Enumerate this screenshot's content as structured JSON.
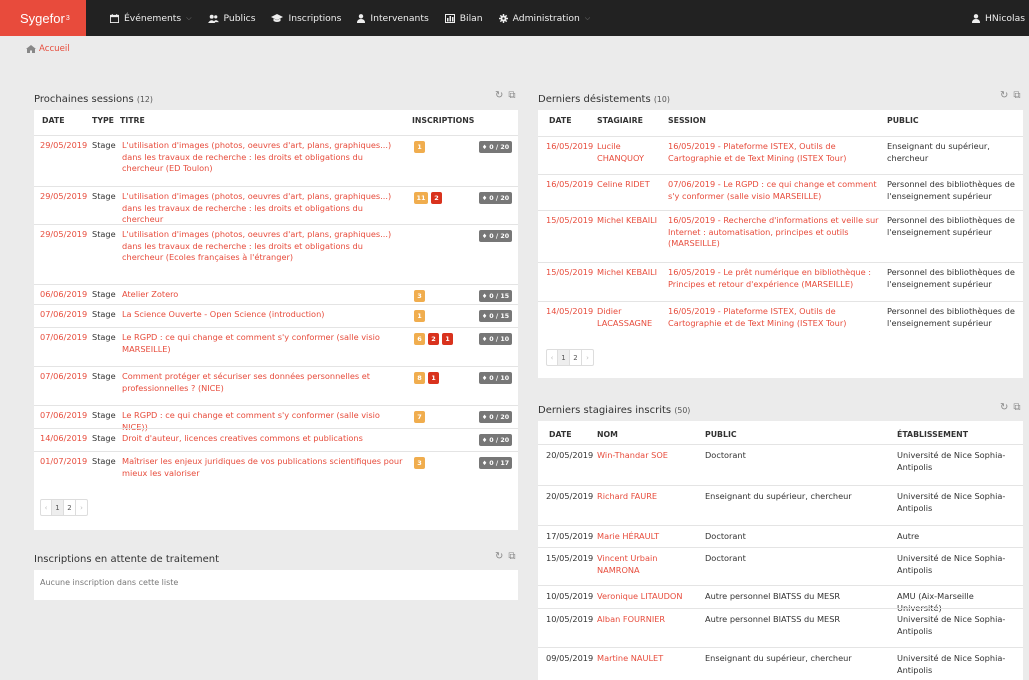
{
  "navbar": {
    "brand": "Sygefor",
    "brand_sup": "3",
    "items": [
      {
        "label": "Événements",
        "icon": "calendar-icon",
        "dropdown": true
      },
      {
        "label": "Publics",
        "icon": "users-icon",
        "dropdown": false
      },
      {
        "label": "Inscriptions",
        "icon": "graduation-cap-icon",
        "dropdown": false
      },
      {
        "label": "Intervenants",
        "icon": "user-icon",
        "dropdown": false
      },
      {
        "label": "Bilan",
        "icon": "bar-chart-icon",
        "dropdown": false
      },
      {
        "label": "Administration",
        "icon": "gear-icon",
        "dropdown": true
      }
    ],
    "user": "HNicolas"
  },
  "breadcrumb": {
    "label": "Accueil",
    "icon": "home-icon"
  },
  "sessions": {
    "title": "Prochaines sessions",
    "count": "(12)",
    "headers": {
      "date": "DATE",
      "type": "TYPE",
      "titre": "TITRE",
      "inscriptions": "INSCRIPTIONS"
    },
    "rows": [
      {
        "date": "29/05/2019",
        "type": "Stage",
        "title": "L'utilisation d'images (photos, oeuvres d'art, plans, graphiques...) dans les travaux de recherche : les droits et obligations du chercheur (ED Toulon)",
        "badges": [
          {
            "v": "1",
            "c": "orange"
          }
        ],
        "cap": "0 / 20"
      },
      {
        "date": "29/05/2019",
        "type": "Stage",
        "title": "L'utilisation d'images (photos, oeuvres d'art, plans, graphiques...) dans les travaux de recherche : les droits et obligations du chercheur",
        "badges": [
          {
            "v": "11",
            "c": "orange"
          },
          {
            "v": "2",
            "c": "red"
          }
        ],
        "cap": "0 / 20"
      },
      {
        "date": "29/05/2019",
        "type": "Stage",
        "title": "L'utilisation d'images (photos, oeuvres d'art, plans, graphiques...) dans les travaux de recherche : les droits et obligations du chercheur (Ecoles françaises à l'étranger)",
        "badges": [],
        "cap": "0 / 20"
      },
      {
        "date": "06/06/2019",
        "type": "Stage",
        "title": "Atelier Zotero",
        "badges": [
          {
            "v": "3",
            "c": "orange"
          }
        ],
        "cap": "0 / 15"
      },
      {
        "date": "07/06/2019",
        "type": "Stage",
        "title": "La Science Ouverte - Open Science (introduction)",
        "badges": [
          {
            "v": "1",
            "c": "orange"
          }
        ],
        "cap": "0 / 15"
      },
      {
        "date": "07/06/2019",
        "type": "Stage",
        "title": "Le RGPD : ce qui change et comment s'y conformer (salle visio MARSEILLE)",
        "badges": [
          {
            "v": "6",
            "c": "orange"
          },
          {
            "v": "2",
            "c": "red"
          },
          {
            "v": "1",
            "c": "red"
          }
        ],
        "cap": "0 / 10"
      },
      {
        "date": "07/06/2019",
        "type": "Stage",
        "title": "Comment protéger et sécuriser ses données personnelles et professionnelles ? (NICE)",
        "badges": [
          {
            "v": "8",
            "c": "orange"
          },
          {
            "v": "1",
            "c": "red"
          }
        ],
        "cap": "0 / 10"
      },
      {
        "date": "07/06/2019",
        "type": "Stage",
        "title": "Le RGPD : ce qui change et comment s'y conformer (salle visio NICE))",
        "badges": [
          {
            "v": "7",
            "c": "orange"
          }
        ],
        "cap": "0 / 20"
      },
      {
        "date": "14/06/2019",
        "type": "Stage",
        "title": "Droit d'auteur, licences creatives commons et publications",
        "badges": [],
        "cap": "0 / 20"
      },
      {
        "date": "01/07/2019",
        "type": "Stage",
        "title": "Maîtriser les enjeux juridiques de vos publications scientifiques pour mieux les valoriser",
        "badges": [
          {
            "v": "3",
            "c": "orange"
          }
        ],
        "cap": "0 / 17"
      }
    ],
    "pager": {
      "prev": "‹",
      "pages": [
        "1",
        "2"
      ],
      "next": "›"
    }
  },
  "pending": {
    "title": "Inscriptions en attente de traitement",
    "empty": "Aucune inscription dans cette liste"
  },
  "desist": {
    "title": "Derniers désistements",
    "count": "(10)",
    "headers": {
      "date": "DATE",
      "stagiaire": "STAGIAIRE",
      "session": "SESSION",
      "public": "PUBLIC"
    },
    "rows": [
      {
        "date": "16/05/2019",
        "name": "Lucile CHANQUOY",
        "session": "16/05/2019 - Plateforme ISTEX, Outils de Cartographie et de Text Mining (ISTEX Tour)",
        "public": "Enseignant du supérieur, chercheur"
      },
      {
        "date": "16/05/2019",
        "name": "Celine RIDET",
        "session": "07/06/2019 - Le RGPD : ce qui change et comment s'y conformer (salle visio MARSEILLE)",
        "public": "Personnel des bibliothèques de l'enseignement supérieur"
      },
      {
        "date": "15/05/2019",
        "name": "Michel KEBAILI",
        "session": "16/05/2019 - Recherche d'informations et veille sur Internet : automatisation, principes et outils (MARSEILLE)",
        "public": "Personnel des bibliothèques de l'enseignement supérieur"
      },
      {
        "date": "15/05/2019",
        "name": "Michel KEBAILI",
        "session": "16/05/2019 - Le prêt numérique en bibliothèque : Principes et retour d'expérience (MARSEILLE)",
        "public": "Personnel des bibliothèques de l'enseignement supérieur"
      },
      {
        "date": "14/05/2019",
        "name": "Didier LACASSAGNE",
        "session": "16/05/2019 - Plateforme ISTEX, Outils de Cartographie et de Text Mining (ISTEX Tour)",
        "public": "Personnel des bibliothèques de l'enseignement supérieur"
      }
    ],
    "pager": {
      "prev": "‹",
      "pages": [
        "1",
        "2"
      ],
      "next": "›"
    }
  },
  "trainees": {
    "title": "Derniers stagiaires inscrits",
    "count": "(50)",
    "headers": {
      "date": "DATE",
      "nom": "NOM",
      "public": "PUBLIC",
      "etab": "ÉTABLISSEMENT"
    },
    "rows": [
      {
        "date": "20/05/2019",
        "name": "Win-Thandar SOE",
        "public": "Doctorant",
        "etab": "Université de Nice Sophia-Antipolis"
      },
      {
        "date": "20/05/2019",
        "name": "Richard FAURE",
        "public": "Enseignant du supérieur, chercheur",
        "etab": "Université de Nice Sophia-Antipolis"
      },
      {
        "date": "17/05/2019",
        "name": "Marie HÉRAULT",
        "public": "Doctorant",
        "etab": "Autre"
      },
      {
        "date": "15/05/2019",
        "name": "Vincent Urbain NAMRONA",
        "public": "Doctorant",
        "etab": "Université de Nice Sophia-Antipolis"
      },
      {
        "date": "10/05/2019",
        "name": "Veronique LITAUDON",
        "public": "Autre personnel BIATSS du MESR",
        "etab": "AMU (Aix-Marseille Université)"
      },
      {
        "date": "10/05/2019",
        "name": "Alban FOURNIER",
        "public": "Autre personnel BIATSS du MESR",
        "etab": "Université de Nice Sophia-Antipolis"
      },
      {
        "date": "09/05/2019",
        "name": "Martine NAULET",
        "public": "Enseignant du supérieur, chercheur",
        "etab": "Université de Nice Sophia-Antipolis"
      }
    ]
  },
  "colors": {
    "brand": "#e84b3c",
    "link": "#e74c3c",
    "badge_orange": "#f0ad4e",
    "badge_red": "#d9321d",
    "capacity": "#777777"
  }
}
